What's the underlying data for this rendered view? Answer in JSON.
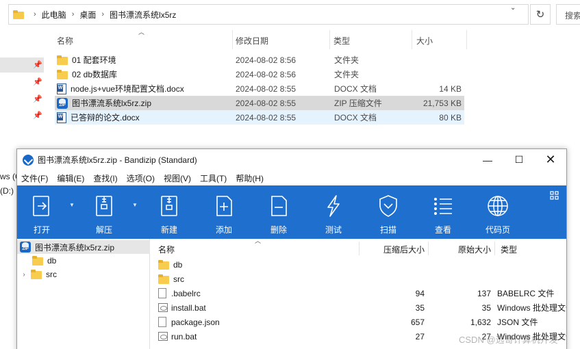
{
  "explorer": {
    "breadcrumb": [
      "此电脑",
      "桌面",
      "图书漂流系统lx5rz"
    ],
    "search_placeholder": "搜索",
    "nav_fragments": [
      "ws (C",
      "(D:)"
    ],
    "columns": {
      "name": "名称",
      "date": "修改日期",
      "type": "类型",
      "size": "大小"
    },
    "files": [
      {
        "name": "01  配套环境",
        "date": "2024-08-02 8:56",
        "type": "文件夹",
        "size": "",
        "icon": "folder-icon"
      },
      {
        "name": "02 db数据库",
        "date": "2024-08-02 8:56",
        "type": "文件夹",
        "size": "",
        "icon": "folder-icon"
      },
      {
        "name": "node.js+vue环境配置文档.docx",
        "date": "2024-08-02 8:55",
        "type": "DOCX 文档",
        "size": "14 KB",
        "icon": "docx-icon"
      },
      {
        "name": "图书漂流系统lx5rz.zip",
        "date": "2024-08-02 8:55",
        "type": "ZIP 压缩文件",
        "size": "21,753 KB",
        "icon": "zip-icon"
      },
      {
        "name": "已答辩的论文.docx",
        "date": "2024-08-02 8:55",
        "type": "DOCX 文档",
        "size": "80 KB",
        "icon": "docx-icon"
      }
    ]
  },
  "bandizip": {
    "title": "图书漂流系统lx5rz.zip - Bandizip (Standard)",
    "menu": [
      "文件(F)",
      "编辑(E)",
      "查找(I)",
      "选项(O)",
      "视图(V)",
      "工具(T)",
      "帮助(H)"
    ],
    "toolbar": [
      "打开",
      "解压",
      "新建",
      "添加",
      "删除",
      "测试",
      "扫描",
      "查看",
      "代码页"
    ],
    "tree": [
      {
        "label": "图书漂流系统lx5rz.zip"
      },
      {
        "label": "db"
      },
      {
        "label": "src"
      }
    ],
    "columns": {
      "name": "名称",
      "compressed": "压缩后大小",
      "original": "原始大小",
      "type": "类型"
    },
    "entries": [
      {
        "name": "db",
        "compressed": "",
        "original": "",
        "type": "",
        "icon": "folder-icon"
      },
      {
        "name": "src",
        "compressed": "",
        "original": "",
        "type": "",
        "icon": "folder-icon"
      },
      {
        "name": ".babelrc",
        "compressed": "94",
        "original": "137",
        "type": "BABELRC 文件",
        "icon": "file-icon"
      },
      {
        "name": "install.bat",
        "compressed": "35",
        "original": "35",
        "type": "Windows 批处理文件",
        "icon": "bat-icon"
      },
      {
        "name": "package.json",
        "compressed": "657",
        "original": "1,632",
        "type": "JSON 文件",
        "icon": "file-icon"
      },
      {
        "name": "run.bat",
        "compressed": "27",
        "original": "27",
        "type": "Windows 批处理文件",
        "icon": "bat-icon"
      }
    ]
  },
  "watermark": "CSDN @远哥计算机开发",
  "colors": {
    "toolbar_bg": "#1f6fce",
    "selection": "#d9d9d9",
    "hover": "#e5f3ff"
  }
}
